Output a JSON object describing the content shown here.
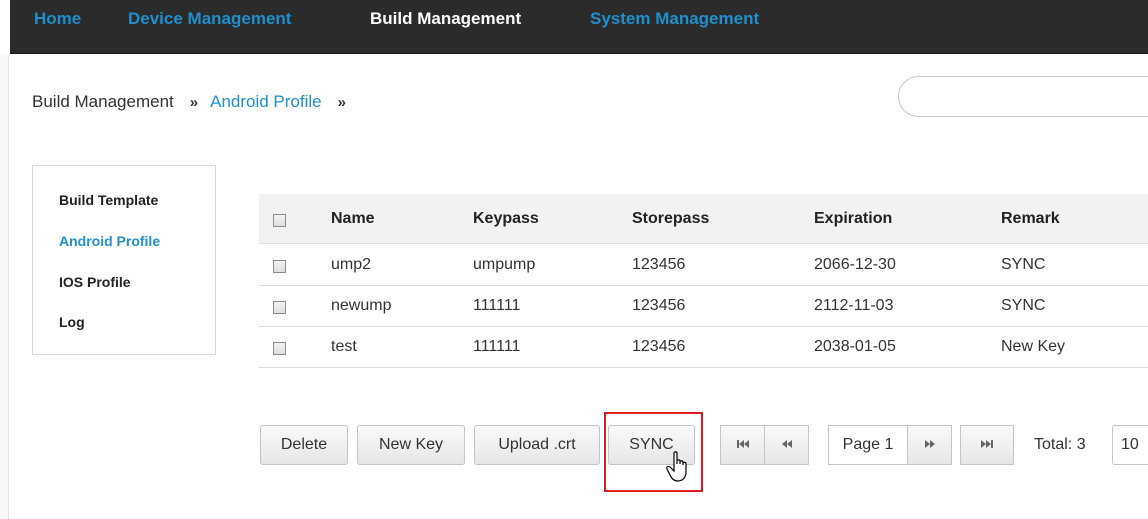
{
  "topnav": {
    "items": [
      "Home",
      "Device Management",
      "Build Management",
      "System Management"
    ],
    "active": "Build Management"
  },
  "breadcrumb": {
    "items": [
      "Build Management",
      "Android Profile"
    ],
    "separator": "»"
  },
  "search": {
    "placeholder": "",
    "value": ""
  },
  "sidemenu": {
    "items": [
      "Build Template",
      "Android Profile",
      "IOS Profile",
      "Log"
    ],
    "active": "Android Profile"
  },
  "table": {
    "columns": [
      "Name",
      "Keypass",
      "Storepass",
      "Expiration",
      "Remark"
    ],
    "rows": [
      [
        "ump2",
        "umpump",
        "123456",
        "2066-12-30",
        "SYNC"
      ],
      [
        "newump",
        "111111",
        "123456",
        "2112-11-03",
        "SYNC"
      ],
      [
        "test",
        "111111",
        "123456",
        "2038-01-05",
        "New Key"
      ]
    ]
  },
  "actions": {
    "delete_label": "Delete",
    "new_key_label": "New Key",
    "upload_label": "Upload .crt",
    "sync_label": "SYNC"
  },
  "pager": {
    "first_icon": "first-page-icon",
    "prev_icon": "previous-page-icon",
    "page_label": "Page 1",
    "next_icon": "next-page-icon",
    "last_icon": "last-page-icon",
    "total_label": "Total: 3",
    "page_size": "10"
  },
  "colors": {
    "nav_background": "#2b2b2b",
    "link_blue": "#1f8fce",
    "highlight_red": "#e02020"
  }
}
